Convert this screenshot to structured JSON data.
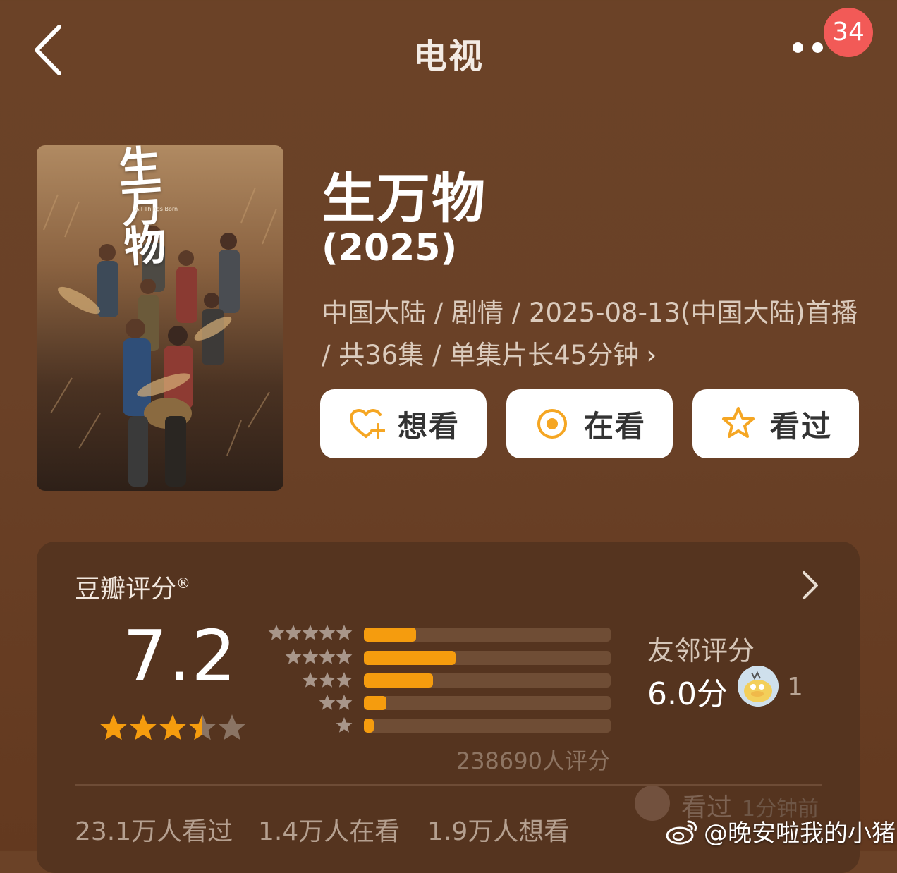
{
  "header": {
    "title": "电视",
    "badge_count": "34",
    "icons": {
      "back": "back-chevron-icon",
      "more": "more-dots-icon"
    }
  },
  "poster": {
    "title_art": "生万物",
    "subtitle_art": "All Things Born"
  },
  "movie": {
    "name": "生万物",
    "year": "(2025)",
    "meta": "中国大陆 / 剧情 / 2025-08-13(中国大陆)首播 / 共36集 / 单集片长45分钟",
    "meta_chevron": "›"
  },
  "actions": [
    {
      "label": "想看",
      "icon": "heart-plus-icon"
    },
    {
      "label": "在看",
      "icon": "target-circle-icon"
    },
    {
      "label": "看过",
      "icon": "star-outline-icon"
    }
  ],
  "rating": {
    "title": "豆瓣评分",
    "registered": "®",
    "score": "7.2",
    "stars": 3.5,
    "distribution": [
      {
        "stars": 5,
        "percent": 21
      },
      {
        "stars": 4,
        "percent": 37
      },
      {
        "stars": 3,
        "percent": 28
      },
      {
        "stars": 2,
        "percent": 9
      },
      {
        "stars": 1,
        "percent": 4
      }
    ],
    "count_text": "238690人评分"
  },
  "friends": {
    "title": "友邻评分",
    "score": "6.0分",
    "count": "1"
  },
  "activity": {
    "action": "看过",
    "time": "1分钟前"
  },
  "stats": {
    "watched": "23.1万人看过",
    "watching": "1.4万人在看",
    "want": "1.9万人想看"
  },
  "watermark": {
    "text": "@晚安啦我的小猪",
    "icon": "weibo-logo-icon"
  },
  "colors": {
    "background": "#6b4227",
    "card": "#55341f",
    "accent": "#f59c0e",
    "badge": "#f25a57",
    "button_icon": "#f5a623"
  }
}
